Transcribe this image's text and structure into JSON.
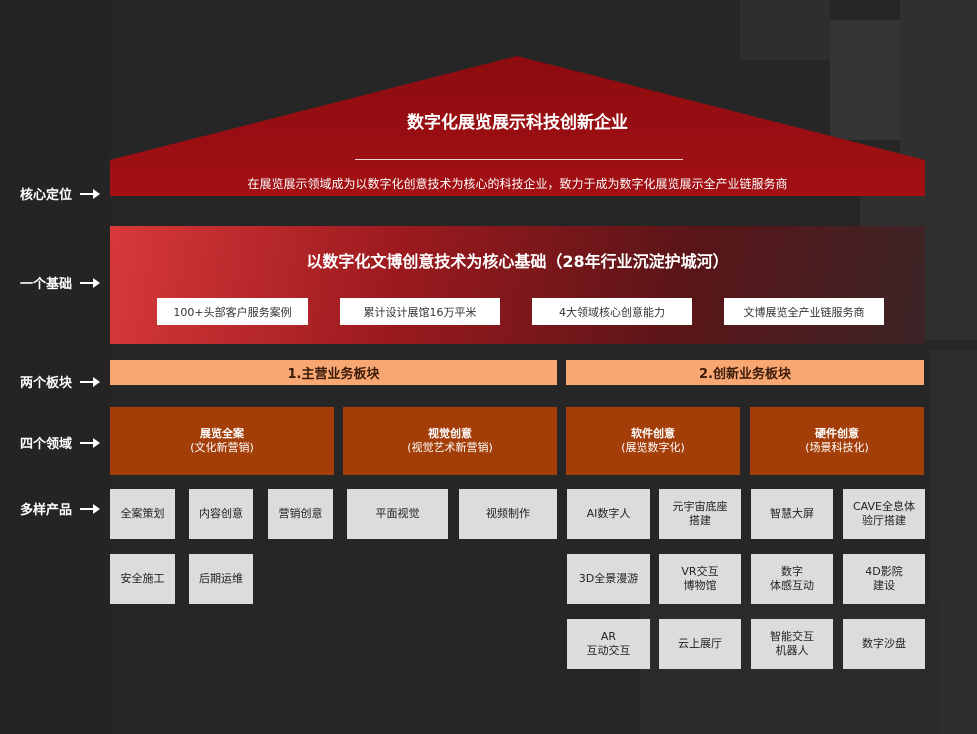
{
  "roof": {
    "title": "数字化展览展示科技创新企业",
    "subtitle": "在展览展示领域成为以数字化创意技术为核心的科技企业，致力于成为数字化展览展示全产业链服务商"
  },
  "row_labels": {
    "core": "核心定位",
    "foundation": "一个基础",
    "segments": "两个板块",
    "domains": "四个领域",
    "products": "多样产品"
  },
  "foundation": {
    "title": "以数字化文博创意技术为核心基础（28年行业沉淀护城河）",
    "pills": [
      "100+头部客户服务案例",
      "累计设计展馆16万平米",
      "4大领域核心创意能力",
      "文博展览全产业链服务商"
    ]
  },
  "segments": [
    "1.主营业务板块",
    "2.创新业务板块"
  ],
  "domains": [
    {
      "name": "展览全案",
      "sub": "(文化新营销)"
    },
    {
      "name": "视觉创意",
      "sub": "(视觉艺术新营销)"
    },
    {
      "name": "软件创意",
      "sub": "(展览数字化)"
    },
    {
      "name": "硬件创意",
      "sub": "(场景科技化)"
    }
  ],
  "products": {
    "exhibition": [
      "全案策划",
      "内容创意",
      "营销创意",
      "安全施工",
      "后期运维"
    ],
    "visual": [
      "平面视觉",
      "视频制作"
    ],
    "software": [
      [
        "AI数字人"
      ],
      [
        "元宇宙底座",
        "搭建"
      ],
      [
        "3D全景漫游"
      ],
      [
        "VR交互",
        "博物馆"
      ],
      [
        "AR",
        "互动交互"
      ],
      [
        "云上展厅"
      ]
    ],
    "hardware": [
      [
        "智慧大屏"
      ],
      [
        "CAVE全息体",
        "验厅搭建"
      ],
      [
        "数字",
        "体感互动"
      ],
      [
        "4D影院",
        "建设"
      ],
      [
        "智能交互",
        "机器人"
      ],
      [
        "数字沙盘"
      ]
    ]
  },
  "colors": {
    "roof": "#9e0f12",
    "foundation_start": "#d8393a",
    "segment": "#f9a772",
    "domain": "#a43e09",
    "product": "#dcdcdc",
    "background": "#262626"
  }
}
